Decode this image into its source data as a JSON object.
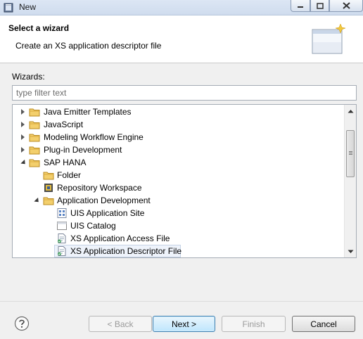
{
  "window": {
    "title": "New"
  },
  "banner": {
    "title": "Select a wizard",
    "description": "Create an XS application descriptor file"
  },
  "wizards": {
    "label": "Wizards:",
    "filter_placeholder": "type filter text",
    "items": [
      {
        "label": "Java Emitter Templates",
        "icon": "folder-icon",
        "state": "collapsed"
      },
      {
        "label": "JavaScript",
        "icon": "folder-icon",
        "state": "collapsed"
      },
      {
        "label": "Modeling Workflow Engine",
        "icon": "folder-icon",
        "state": "collapsed"
      },
      {
        "label": "Plug-in Development",
        "icon": "folder-icon",
        "state": "collapsed"
      },
      {
        "label": "SAP HANA",
        "icon": "folder-icon",
        "state": "expanded"
      },
      {
        "label": "Folder",
        "icon": "folder-icon",
        "state": "leaf"
      },
      {
        "label": "Repository Workspace",
        "icon": "workspace-icon",
        "state": "leaf"
      },
      {
        "label": "Application Development",
        "icon": "folder-icon",
        "state": "expanded"
      },
      {
        "label": "UIS Application Site",
        "icon": "site-icon",
        "state": "leaf"
      },
      {
        "label": "UIS Catalog",
        "icon": "catalog-icon",
        "state": "leaf"
      },
      {
        "label": "XS Application Access File",
        "icon": "file-icon",
        "state": "leaf"
      },
      {
        "label": "XS Application Descriptor File",
        "icon": "file-icon",
        "state": "leaf",
        "selected": true
      }
    ]
  },
  "buttons": {
    "back": "< Back",
    "next": "Next >",
    "finish": "Finish",
    "cancel": "Cancel"
  },
  "colors": {
    "folder": "#e8b94a",
    "selection": "#eef3fb",
    "accent": "#3c7fb1"
  }
}
